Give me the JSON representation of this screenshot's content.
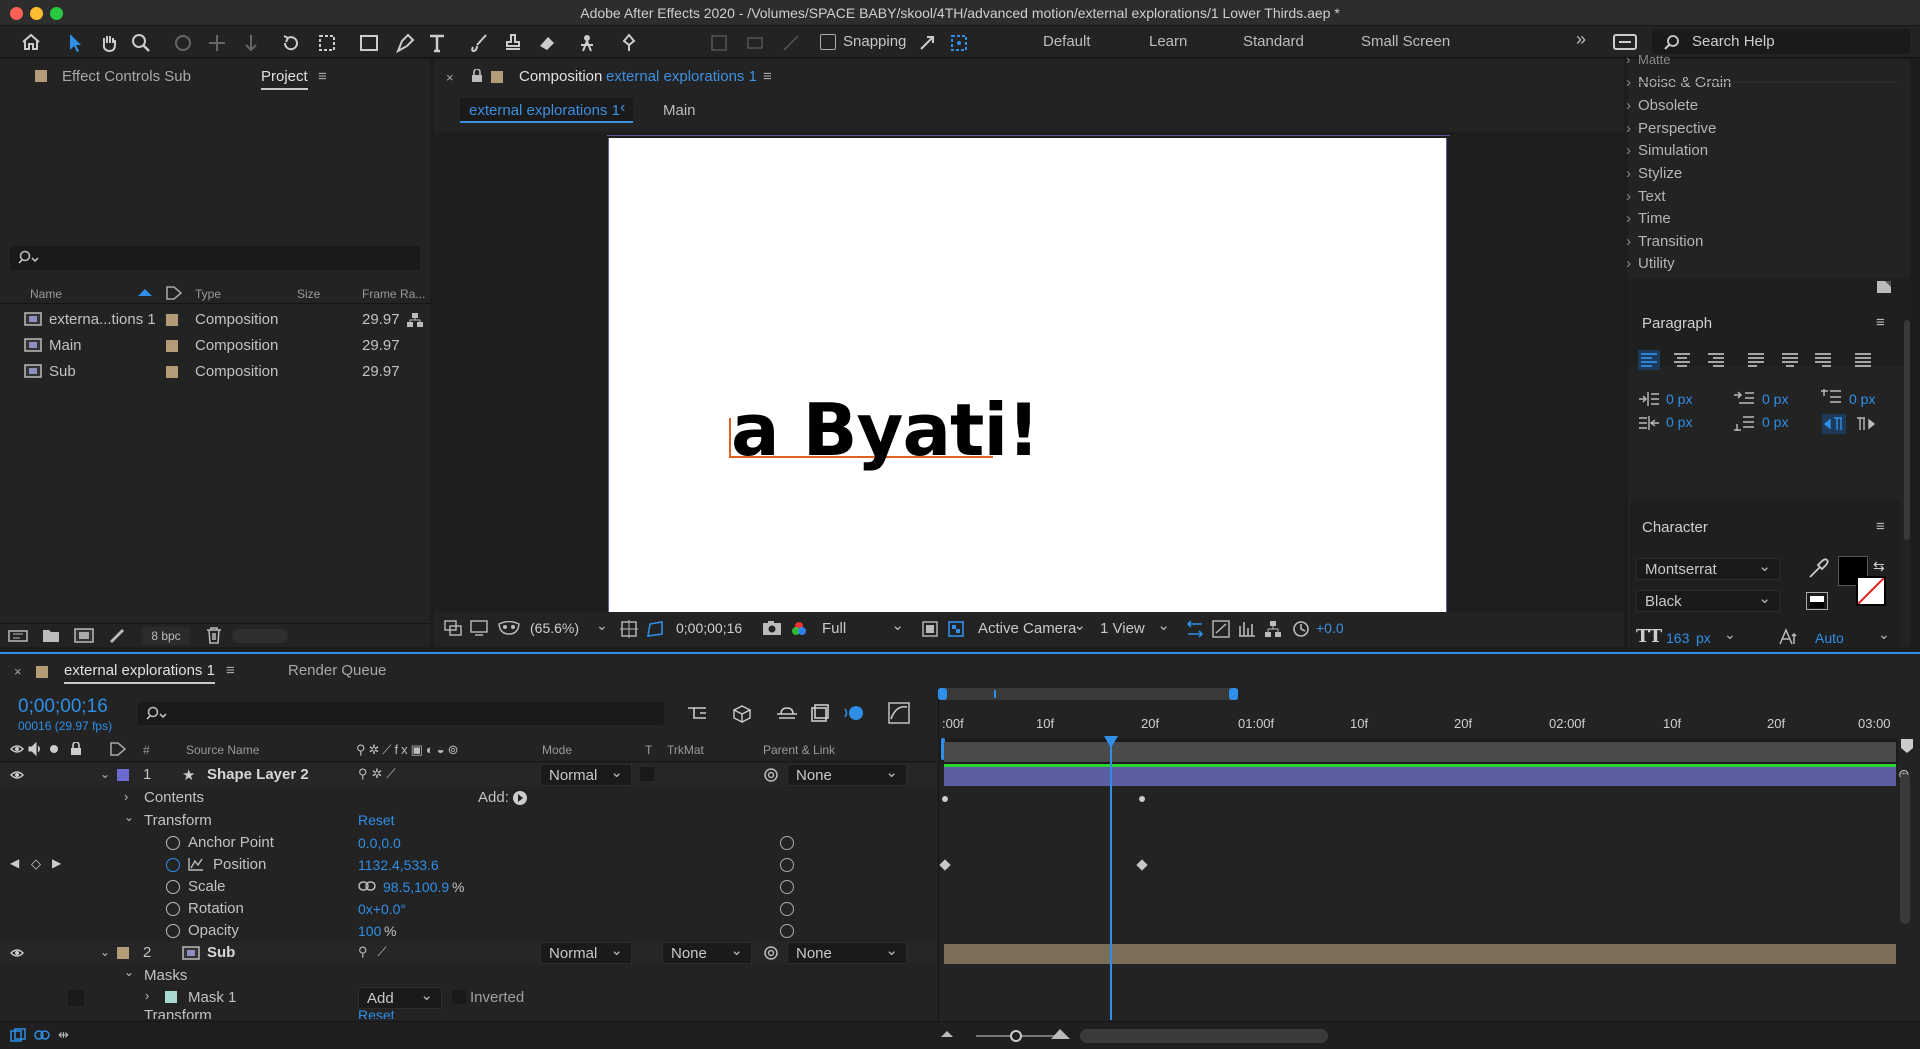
{
  "window": {
    "title": "Adobe After Effects 2020 - /Volumes/SPACE BABY/skool/4TH/advanced motion/external explorations/1 Lower Thirds.aep *"
  },
  "toolbar": {
    "snapping": "Snapping",
    "workspaces": [
      "Default",
      "Learn",
      "Standard",
      "Small Screen"
    ],
    "search_placeholder": "Search Help",
    "more": "»"
  },
  "left_panel": {
    "tabs": [
      "Effect Controls Sub",
      "Project"
    ],
    "menu": "≡",
    "columns": [
      "Name",
      "Type",
      "Size",
      "Frame Ra..."
    ],
    "items": [
      {
        "name": "externa...tions 1",
        "type": "Composition",
        "fps": "29.97"
      },
      {
        "name": "Main",
        "type": "Composition",
        "fps": "29.97"
      },
      {
        "name": "Sub",
        "type": "Composition",
        "fps": "29.97"
      }
    ],
    "bpc": "8 bpc"
  },
  "comp_panel": {
    "label": "Composition",
    "comp_name": "external explorations 1",
    "menu": "≡",
    "breadcrumb": [
      "external explorations 1",
      "Main"
    ],
    "canvas_text": "a Byati!",
    "zoom": "(65.6%)",
    "timecode": "0;00;00;16",
    "resolution": "Full",
    "camera": "Active Camera",
    "view": "1 View",
    "exposure": "+0.0"
  },
  "effects_list": [
    "Matte",
    "Noise & Grain",
    "Obsolete",
    "Perspective",
    "Simulation",
    "Stylize",
    "Text",
    "Time",
    "Transition",
    "Utility"
  ],
  "paragraph": {
    "title": "Paragraph",
    "menu": "≡",
    "values": [
      "0 px",
      "0 px",
      "0 px",
      "0 px",
      "0 px"
    ]
  },
  "character": {
    "title": "Character",
    "menu": "≡",
    "font": "Montserrat",
    "style": "Black",
    "size": "163",
    "size_unit": "px",
    "leading": "Auto"
  },
  "timeline": {
    "tabs": [
      "external explorations 1",
      "Render Queue"
    ],
    "menu": "≡",
    "timecode": "0;00;00;16",
    "fps_info": "00016 (29.97 fps)",
    "columns": {
      "num": "#",
      "source": "Source Name",
      "mode": "Mode",
      "t": "T",
      "trkmat": "TrkMat",
      "parent": "Parent & Link"
    },
    "layer1": {
      "num": "1",
      "name": "Shape Layer 2",
      "mode": "Normal",
      "parent": "None"
    },
    "contents": "Contents",
    "add": "Add:",
    "transform": "Transform",
    "reset": "Reset",
    "anchor": {
      "label": "Anchor Point",
      "value": "0.0,0.0"
    },
    "position": {
      "label": "Position",
      "value": "1132.4,533.6"
    },
    "scale": {
      "label": "Scale",
      "value": "98.5,100.9",
      "unit": "%"
    },
    "rotation": {
      "label": "Rotation",
      "value": "0x+0.0°"
    },
    "opacity": {
      "label": "Opacity",
      "value": "100",
      "unit": "%"
    },
    "layer2": {
      "num": "2",
      "name": "Sub",
      "mode": "Normal",
      "trkmat": "None",
      "parent": "None"
    },
    "masks": "Masks",
    "mask1": {
      "label": "Mask 1",
      "mode": "Add",
      "inverted": "Inverted"
    },
    "transform2": {
      "label": "Transform",
      "reset": "Reset"
    },
    "ruler": [
      ":00f",
      "10f",
      "20f",
      "01:00f",
      "10f",
      "20f",
      "02:00f",
      "10f",
      "20f",
      "03:00"
    ]
  },
  "colors": {
    "accent": "#2f8fe8",
    "layer1_bar": "#5b5fa0",
    "layer2_bar": "#7b6f5a",
    "orange": "#e06020",
    "green": "#2bd431"
  }
}
